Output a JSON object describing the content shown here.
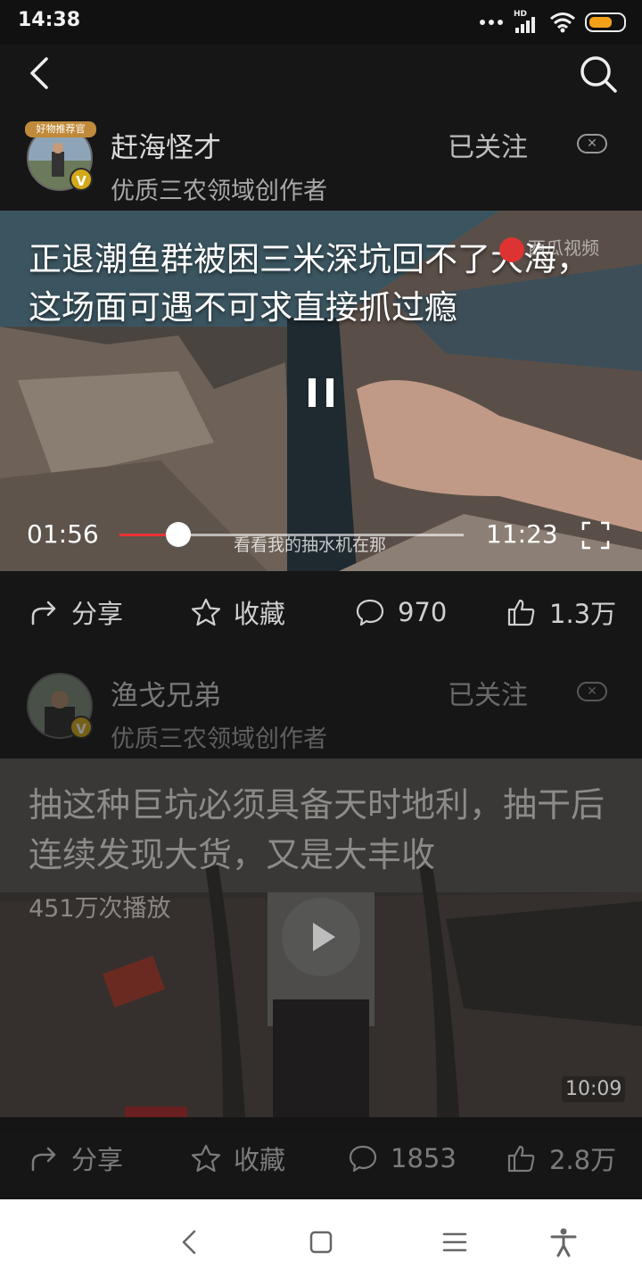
{
  "status_bar": {
    "time": "14:38",
    "network": "HD"
  },
  "post1": {
    "author": {
      "name": "赶海怪才",
      "description": "优质三农领域创作者",
      "follow_label": "已关注",
      "avatar_ribbon": "好物推荐官"
    },
    "video": {
      "title": "正退潮鱼群被困三米深坑回不了大海，这场面可遇不可求直接抓过瘾",
      "watermark": "西瓜视频",
      "current_time": "01:56",
      "total_time": "11:23",
      "subtitle": "看看我的抽水机在那",
      "progress_fraction": 0.17
    },
    "actions": {
      "share": "分享",
      "favorite": "收藏",
      "comments": "970",
      "likes": "1.3万"
    }
  },
  "post2": {
    "author": {
      "name": "渔戈兄弟",
      "description": "优质三农领域创作者",
      "follow_label": "已关注"
    },
    "video": {
      "title": "抽这种巨坑必须具备天时地利，抽干后连续发现大货，又是大丰收",
      "play_count": "451万次播放",
      "duration": "10:09"
    },
    "actions": {
      "share": "分享",
      "favorite": "收藏",
      "comments": "1853",
      "likes": "2.8万"
    }
  },
  "icons": [
    "back-icon",
    "search-icon",
    "share-icon",
    "star-icon",
    "comment-icon",
    "thumbs-up-icon",
    "pause-icon",
    "play-icon",
    "fullscreen-icon"
  ],
  "colors": {
    "background": "#161616",
    "accent_red": "#e33333",
    "verified_gold": "#d4a919"
  }
}
